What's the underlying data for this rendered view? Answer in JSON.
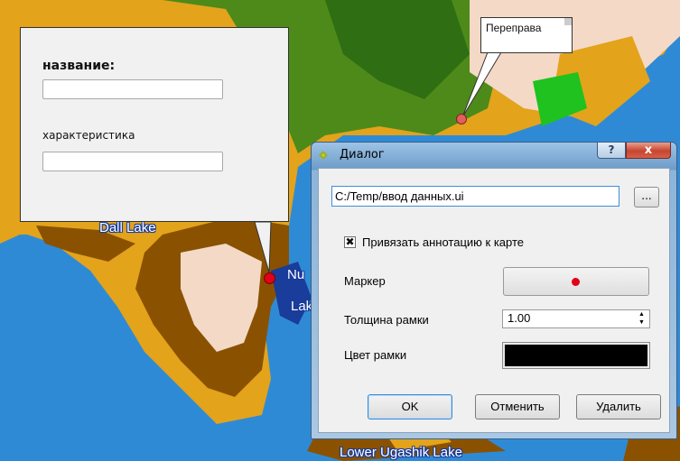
{
  "map": {
    "labels": {
      "dall_lake": "Dall Lake",
      "nu": "Nu",
      "lake": "Lake",
      "lower_ugashik": "Lower Ugashik Lake"
    },
    "colors": {
      "ocean": "#2f8ad6",
      "land_brown": "#8a5200",
      "land_orange": "#e3a31b",
      "land_green": "#4d8a1a",
      "snow": "#f4d9c6"
    }
  },
  "form_annotation": {
    "title": "название:",
    "field2_label": "характеристика",
    "name_value": "",
    "char_value": ""
  },
  "text_annotation": {
    "text": "Переправа"
  },
  "dialog": {
    "title": "Диалог",
    "help_label": "?",
    "close_label": "x",
    "file_path": "C:/Temp/ввод данных.ui",
    "browse_label": "...",
    "attach_checked_mark": "✖",
    "attach_label": "Привязать аннотацию к карте",
    "marker_label": "Маркер",
    "marker_color": "#e2001a",
    "frame_width_label": "Толщина рамки",
    "frame_width_value": "1.00",
    "spin_up": "▲",
    "spin_down": "▼",
    "frame_color_label": "Цвет рамки",
    "frame_color": "#000000",
    "ok_label": "OK",
    "cancel_label": "Отменить",
    "delete_label": "Удалить"
  }
}
